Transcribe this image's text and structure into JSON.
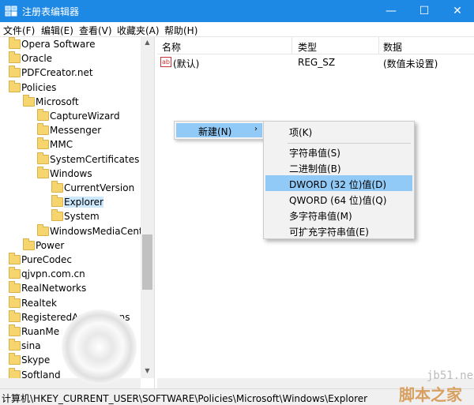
{
  "window": {
    "title": "注册表编辑器",
    "min": "—",
    "max": "☐",
    "close": "✕"
  },
  "menu": [
    "文件(F)",
    "编辑(E)",
    "查看(V)",
    "收藏夹(A)",
    "帮助(H)"
  ],
  "tree": [
    {
      "label": "Opera Software",
      "indent": 0,
      "arrow": ""
    },
    {
      "label": "Oracle",
      "indent": 0,
      "arrow": ""
    },
    {
      "label": "PDFCreator.net",
      "indent": 0,
      "arrow": ""
    },
    {
      "label": "Policies",
      "indent": 0,
      "arrow": "⌄"
    },
    {
      "label": "Microsoft",
      "indent": 1,
      "arrow": "⌄"
    },
    {
      "label": "CaptureWizard",
      "indent": 2,
      "arrow": ""
    },
    {
      "label": "Messenger",
      "indent": 2,
      "arrow": "›"
    },
    {
      "label": "MMC",
      "indent": 2,
      "arrow": ""
    },
    {
      "label": "SystemCertificates",
      "indent": 2,
      "arrow": "›"
    },
    {
      "label": "Windows",
      "indent": 2,
      "arrow": "⌄"
    },
    {
      "label": "CurrentVersion",
      "indent": 3,
      "arrow": "›"
    },
    {
      "label": "Explorer",
      "indent": 3,
      "arrow": "",
      "selected": true
    },
    {
      "label": "System",
      "indent": 3,
      "arrow": ""
    },
    {
      "label": "WindowsMediaCenter",
      "indent": 2,
      "arrow": ""
    },
    {
      "label": "Power",
      "indent": 1,
      "arrow": "›"
    },
    {
      "label": "PureCodec",
      "indent": 0,
      "arrow": ""
    },
    {
      "label": "qjvpn.com.cn",
      "indent": 0,
      "arrow": ""
    },
    {
      "label": "RealNetworks",
      "indent": 0,
      "arrow": ""
    },
    {
      "label": "Realtek",
      "indent": 0,
      "arrow": ""
    },
    {
      "label": "RegisteredApplications",
      "indent": 0,
      "arrow": ""
    },
    {
      "label": "RuanMe",
      "indent": 0,
      "arrow": ""
    },
    {
      "label": "sina",
      "indent": 0,
      "arrow": ""
    },
    {
      "label": "Skype",
      "indent": 0,
      "arrow": ""
    },
    {
      "label": "Softland",
      "indent": 0,
      "arrow": ""
    }
  ],
  "columns": {
    "name": "名称",
    "type": "类型",
    "data": "数据"
  },
  "values": [
    {
      "icon": "ab",
      "name": "(默认)",
      "type": "REG_SZ",
      "data": "(数值未设置)"
    }
  ],
  "context_menu": {
    "new_label": "新建(N)",
    "new_arrow": "›",
    "submenu": [
      {
        "label": "项(K)"
      },
      {
        "label": "字符串值(S)"
      },
      {
        "label": "二进制值(B)"
      },
      {
        "label": "DWORD (32 位)值(D)",
        "highlighted": true
      },
      {
        "label": "QWORD (64 位)值(Q)"
      },
      {
        "label": "多字符串值(M)"
      },
      {
        "label": "可扩充字符串值(E)"
      }
    ]
  },
  "status_path": "计算机\\HKEY_CURRENT_USER\\SOFTWARE\\Policies\\Microsoft\\Windows\\Explorer",
  "watermark": {
    "site": "jb51.net",
    "brand": "脚本之家"
  },
  "colors": {
    "titlebar": "#1e88e5",
    "selection": "#cce8ff",
    "menu_highlight": "#91c9f7",
    "folder": "#f6d56e"
  }
}
